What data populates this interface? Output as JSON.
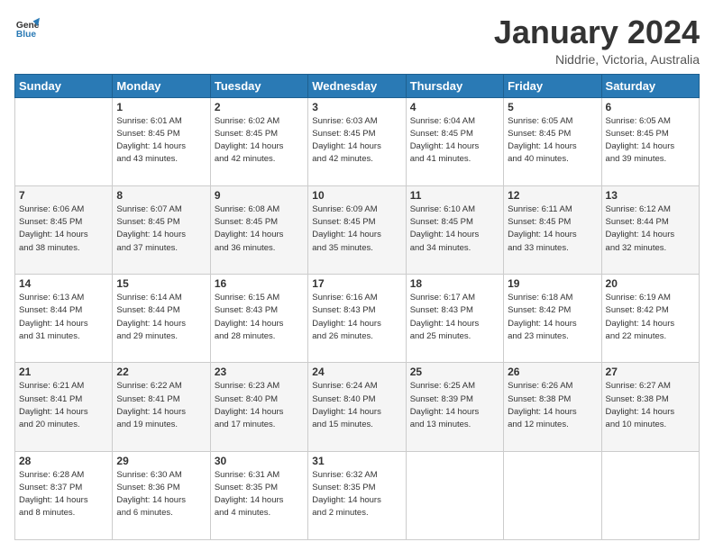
{
  "logo": {
    "line1": "General",
    "line2": "Blue"
  },
  "title": "January 2024",
  "location": "Niddrie, Victoria, Australia",
  "days_of_week": [
    "Sunday",
    "Monday",
    "Tuesday",
    "Wednesday",
    "Thursday",
    "Friday",
    "Saturday"
  ],
  "weeks": [
    [
      {
        "day": "",
        "info": ""
      },
      {
        "day": "1",
        "info": "Sunrise: 6:01 AM\nSunset: 8:45 PM\nDaylight: 14 hours\nand 43 minutes."
      },
      {
        "day": "2",
        "info": "Sunrise: 6:02 AM\nSunset: 8:45 PM\nDaylight: 14 hours\nand 42 minutes."
      },
      {
        "day": "3",
        "info": "Sunrise: 6:03 AM\nSunset: 8:45 PM\nDaylight: 14 hours\nand 42 minutes."
      },
      {
        "day": "4",
        "info": "Sunrise: 6:04 AM\nSunset: 8:45 PM\nDaylight: 14 hours\nand 41 minutes."
      },
      {
        "day": "5",
        "info": "Sunrise: 6:05 AM\nSunset: 8:45 PM\nDaylight: 14 hours\nand 40 minutes."
      },
      {
        "day": "6",
        "info": "Sunrise: 6:05 AM\nSunset: 8:45 PM\nDaylight: 14 hours\nand 39 minutes."
      }
    ],
    [
      {
        "day": "7",
        "info": "Sunrise: 6:06 AM\nSunset: 8:45 PM\nDaylight: 14 hours\nand 38 minutes."
      },
      {
        "day": "8",
        "info": "Sunrise: 6:07 AM\nSunset: 8:45 PM\nDaylight: 14 hours\nand 37 minutes."
      },
      {
        "day": "9",
        "info": "Sunrise: 6:08 AM\nSunset: 8:45 PM\nDaylight: 14 hours\nand 36 minutes."
      },
      {
        "day": "10",
        "info": "Sunrise: 6:09 AM\nSunset: 8:45 PM\nDaylight: 14 hours\nand 35 minutes."
      },
      {
        "day": "11",
        "info": "Sunrise: 6:10 AM\nSunset: 8:45 PM\nDaylight: 14 hours\nand 34 minutes."
      },
      {
        "day": "12",
        "info": "Sunrise: 6:11 AM\nSunset: 8:45 PM\nDaylight: 14 hours\nand 33 minutes."
      },
      {
        "day": "13",
        "info": "Sunrise: 6:12 AM\nSunset: 8:44 PM\nDaylight: 14 hours\nand 32 minutes."
      }
    ],
    [
      {
        "day": "14",
        "info": "Sunrise: 6:13 AM\nSunset: 8:44 PM\nDaylight: 14 hours\nand 31 minutes."
      },
      {
        "day": "15",
        "info": "Sunrise: 6:14 AM\nSunset: 8:44 PM\nDaylight: 14 hours\nand 29 minutes."
      },
      {
        "day": "16",
        "info": "Sunrise: 6:15 AM\nSunset: 8:43 PM\nDaylight: 14 hours\nand 28 minutes."
      },
      {
        "day": "17",
        "info": "Sunrise: 6:16 AM\nSunset: 8:43 PM\nDaylight: 14 hours\nand 26 minutes."
      },
      {
        "day": "18",
        "info": "Sunrise: 6:17 AM\nSunset: 8:43 PM\nDaylight: 14 hours\nand 25 minutes."
      },
      {
        "day": "19",
        "info": "Sunrise: 6:18 AM\nSunset: 8:42 PM\nDaylight: 14 hours\nand 23 minutes."
      },
      {
        "day": "20",
        "info": "Sunrise: 6:19 AM\nSunset: 8:42 PM\nDaylight: 14 hours\nand 22 minutes."
      }
    ],
    [
      {
        "day": "21",
        "info": "Sunrise: 6:21 AM\nSunset: 8:41 PM\nDaylight: 14 hours\nand 20 minutes."
      },
      {
        "day": "22",
        "info": "Sunrise: 6:22 AM\nSunset: 8:41 PM\nDaylight: 14 hours\nand 19 minutes."
      },
      {
        "day": "23",
        "info": "Sunrise: 6:23 AM\nSunset: 8:40 PM\nDaylight: 14 hours\nand 17 minutes."
      },
      {
        "day": "24",
        "info": "Sunrise: 6:24 AM\nSunset: 8:40 PM\nDaylight: 14 hours\nand 15 minutes."
      },
      {
        "day": "25",
        "info": "Sunrise: 6:25 AM\nSunset: 8:39 PM\nDaylight: 14 hours\nand 13 minutes."
      },
      {
        "day": "26",
        "info": "Sunrise: 6:26 AM\nSunset: 8:38 PM\nDaylight: 14 hours\nand 12 minutes."
      },
      {
        "day": "27",
        "info": "Sunrise: 6:27 AM\nSunset: 8:38 PM\nDaylight: 14 hours\nand 10 minutes."
      }
    ],
    [
      {
        "day": "28",
        "info": "Sunrise: 6:28 AM\nSunset: 8:37 PM\nDaylight: 14 hours\nand 8 minutes."
      },
      {
        "day": "29",
        "info": "Sunrise: 6:30 AM\nSunset: 8:36 PM\nDaylight: 14 hours\nand 6 minutes."
      },
      {
        "day": "30",
        "info": "Sunrise: 6:31 AM\nSunset: 8:35 PM\nDaylight: 14 hours\nand 4 minutes."
      },
      {
        "day": "31",
        "info": "Sunrise: 6:32 AM\nSunset: 8:35 PM\nDaylight: 14 hours\nand 2 minutes."
      },
      {
        "day": "",
        "info": ""
      },
      {
        "day": "",
        "info": ""
      },
      {
        "day": "",
        "info": ""
      }
    ]
  ]
}
